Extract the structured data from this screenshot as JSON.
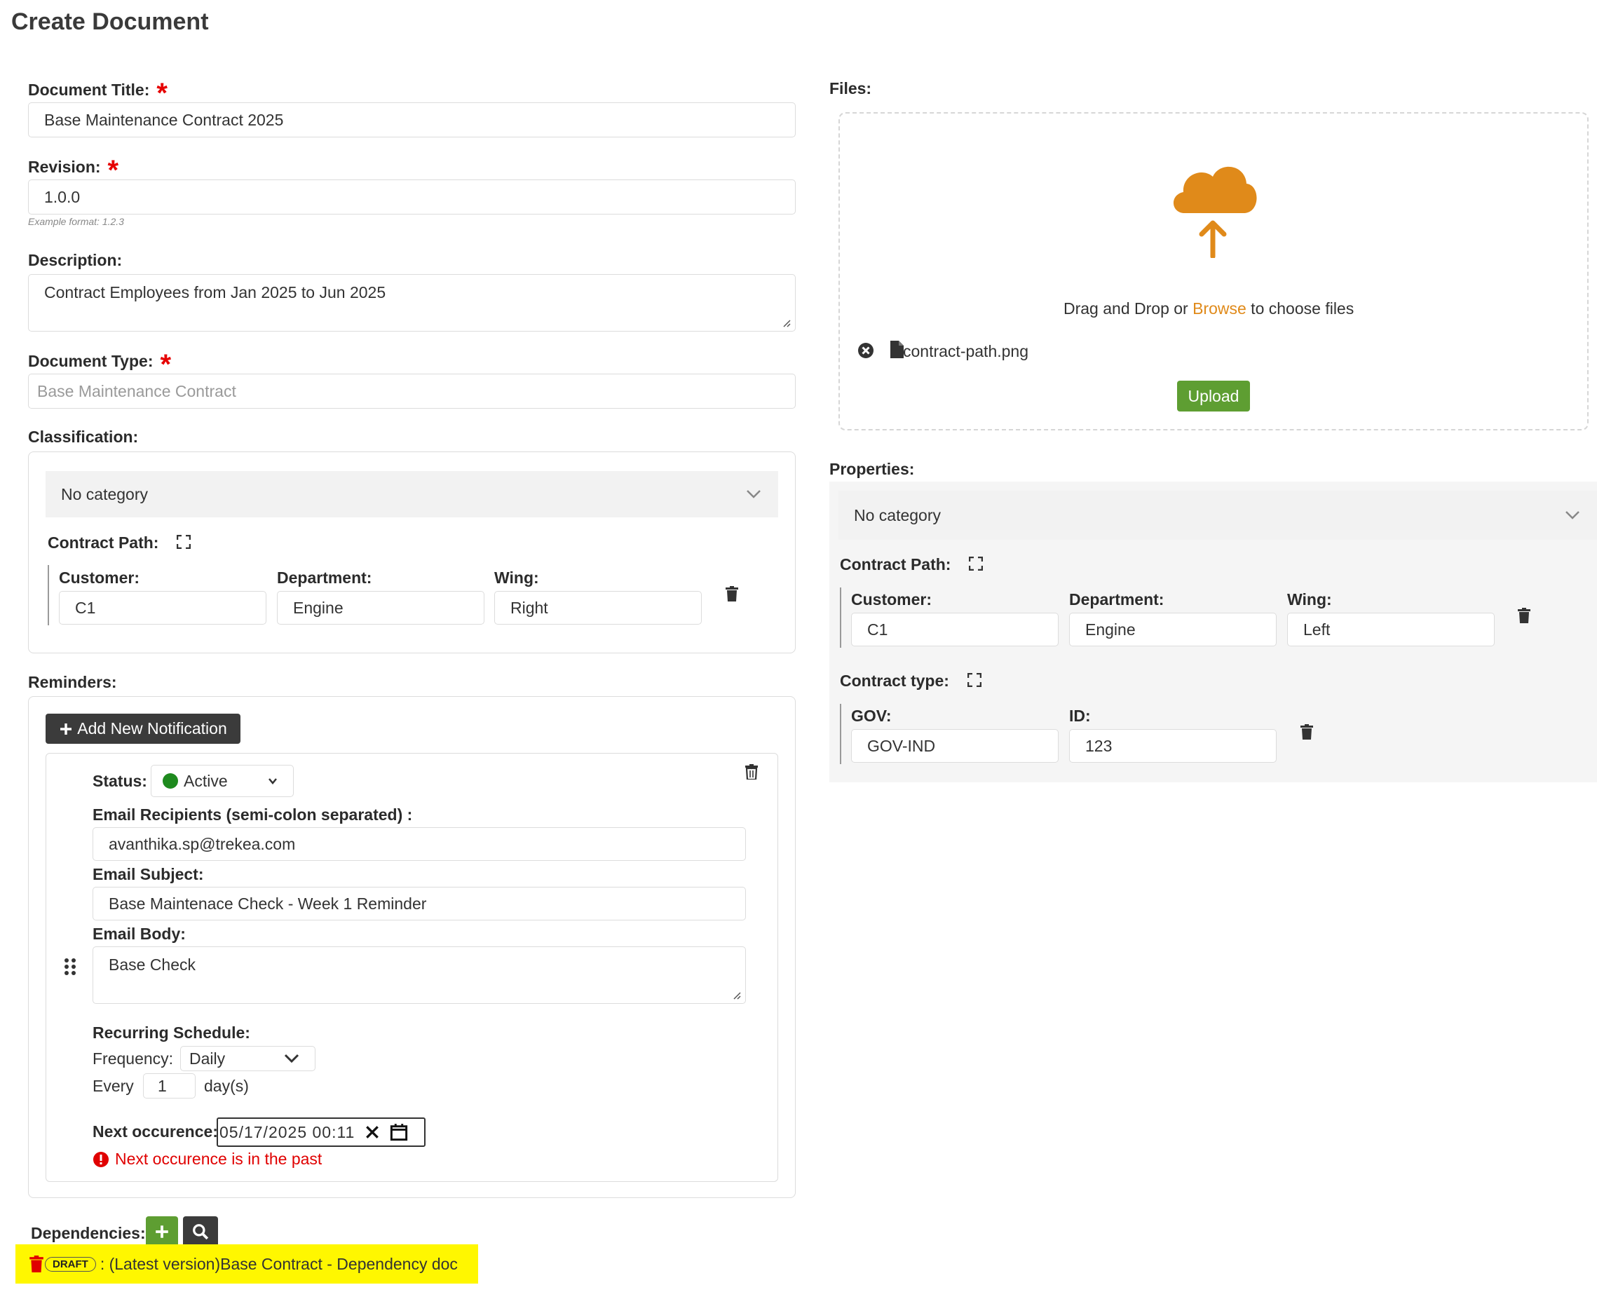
{
  "page": {
    "title": "Create Document"
  },
  "form": {
    "document_title": {
      "label": "Document Title:",
      "value": "Base Maintenance Contract 2025"
    },
    "revision": {
      "label": "Revision:",
      "value": "1.0.0",
      "hint": "Example format: 1.2.3"
    },
    "description": {
      "label": "Description:",
      "value": "Contract Employees from Jan 2025 to Jun 2025"
    },
    "document_type": {
      "label": "Document Type:",
      "placeholder": "Base Maintenance Contract"
    },
    "required_mark": "*"
  },
  "classification": {
    "label": "Classification:",
    "category": "No category",
    "contract_path_label": "Contract Path:",
    "fields": {
      "customer_label": "Customer:",
      "customer": "C1",
      "department_label": "Department:",
      "department": "Engine",
      "wing_label": "Wing:",
      "wing": "Right"
    }
  },
  "reminders": {
    "label": "Reminders:",
    "add_button": "Add New Notification",
    "status_label": "Status:",
    "status_value": "Active",
    "status_color": "#1e8a1e",
    "recipients_label": "Email Recipients (semi-colon separated) :",
    "recipients": "avanthika.sp@trekea.com",
    "subject_label": "Email Subject:",
    "subject": "Base Maintenace Check - Week 1 Reminder",
    "body_label": "Email Body:",
    "body": "Base Check",
    "schedule_label": "Recurring Schedule:",
    "frequency_label": "Frequency:",
    "frequency": "Daily",
    "every_label": "Every",
    "every_value": "1",
    "every_unit": "day(s)",
    "next_label": "Next occurence:",
    "next_value": "05/17/2025 00:11",
    "error": "Next occurence is in the past"
  },
  "dependencies": {
    "label": "Dependencies:",
    "badge": "DRAFT",
    "item_text": ": (Latest version)Base Contract - Dependency doc",
    "highlight_color": "#fff700"
  },
  "files": {
    "label": "Files:",
    "drop_prefix": "Drag and Drop or ",
    "browse": "Browse",
    "drop_suffix": " to choose files",
    "file_name": "contract-path.png",
    "upload_button": "Upload",
    "accent_color": "#e08a1a"
  },
  "properties": {
    "label": "Properties:",
    "category": "No category",
    "contract_path_label": "Contract Path:",
    "path_fields": {
      "customer_label": "Customer:",
      "customer": "C1",
      "department_label": "Department:",
      "department": "Engine",
      "wing_label": "Wing:",
      "wing": "Left"
    },
    "contract_type_label": "Contract type:",
    "type_fields": {
      "gov_label": "GOV:",
      "gov": "GOV-IND",
      "id_label": "ID:",
      "id": "123"
    }
  },
  "icons": [
    "asterisk-icon",
    "chevron-down-icon",
    "expand-icon",
    "trash-icon",
    "plus-icon",
    "drag-handle-icon",
    "calendar-icon",
    "clear-icon",
    "error-icon",
    "cloud-upload-icon",
    "remove-file-icon",
    "file-icon",
    "search-icon"
  ]
}
